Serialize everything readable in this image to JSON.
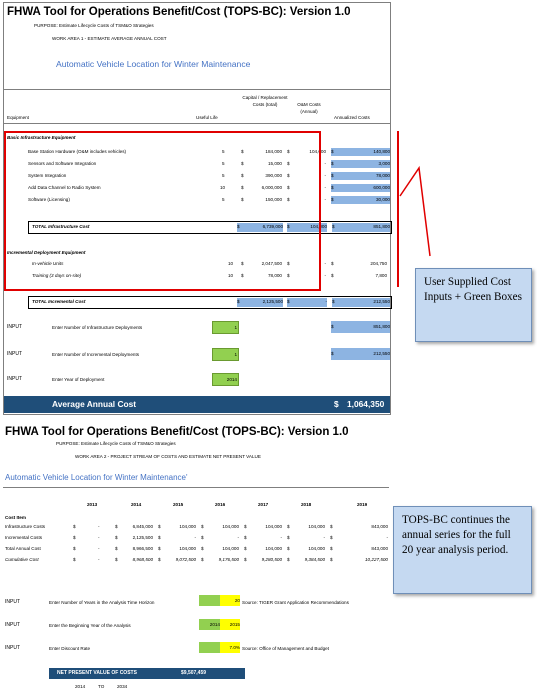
{
  "top": {
    "title": "FHWA Tool for Operations Benefit/Cost (TOPS-BC):  Version 1.0",
    "purpose": "PURPOSE: Estimate Lifecycle Costs of TSM&O Strategies",
    "work_area": "WORK AREA 1 - ESTIMATE AVERAGE ANNUAL COST",
    "subtitle": "Automatic Vehicle Location for Winter Maintenance",
    "headers": {
      "equipment": "Equipment",
      "useful_life": "Useful Life",
      "capital": "Capital / Replacement Costs (total)",
      "om": "O&M Costs (Annual)",
      "annualized": "Annualized Costs"
    },
    "basic_section": "Basic Infrastructure Equipment",
    "basic_rows": [
      {
        "name": "Base Station Hardware (O&M includes vehicles)",
        "life": "5",
        "capital": "184,000",
        "om": "104,000",
        "annual": "140,800"
      },
      {
        "name": "Sensors and Software Integration",
        "life": "5",
        "capital": "15,000",
        "om": "-",
        "annual": "3,000"
      },
      {
        "name": "System Integration",
        "life": "5",
        "capital": "390,000",
        "om": "-",
        "annual": "78,000"
      },
      {
        "name": "Add Data Channel to Radio System",
        "life": "10",
        "capital": "6,000,000",
        "om": "-",
        "annual": "600,000"
      },
      {
        "name": "Software (Licensing)",
        "life": "5",
        "capital": "150,000",
        "om": "-",
        "annual": "30,000"
      }
    ],
    "total_infra": {
      "label": "TOTAL Infrastructure Cost",
      "capital": "6,739,000",
      "om": "104,000",
      "annual": "851,800"
    },
    "incr_section": "Incremental Deployment Equipment",
    "incr_rows": [
      {
        "name": "In-vehicle Units",
        "life": "10",
        "capital": "2,047,500",
        "om": "-",
        "annual": "204,750"
      },
      {
        "name": "Training (3 days on-site)",
        "life": "10",
        "capital": "78,000",
        "om": "-",
        "annual": "7,800"
      }
    ],
    "total_incr": {
      "label": "TOTAL Incremental Cost",
      "capital": "2,125,500",
      "om": "-",
      "annual": "212,550"
    },
    "inputs": [
      {
        "tag": "INPUT",
        "label": "Enter Number of Infrastructure Deployments",
        "value": "1",
        "result": "851,800"
      },
      {
        "tag": "INPUT",
        "label": "Enter Number of Incremental Deployments",
        "value": "1",
        "result": "212,550"
      },
      {
        "tag": "INPUT",
        "label": "Enter Year of Deployment",
        "value": "2014",
        "result": ""
      }
    ],
    "avg_label": "Average Annual Cost",
    "avg_currency": "$",
    "avg_value": "1,064,350"
  },
  "callout1": {
    "text": "User Supplied Cost Inputs + Green Boxes"
  },
  "bottom": {
    "title": "FHWA Tool for Operations Benefit/Cost (TOPS-BC):  Version 1.0",
    "purpose": "PURPOSE: Estimate Lifecycle Costs of TSM&O Strategies",
    "work_area": "WORK AREA 2 - PROJECT STREAM OF COSTS AND ESTIMATE NET PRESENT VALUE",
    "subtitle": "Automatic Vehicle Location for Winter Maintenance'",
    "years": [
      "2013",
      "2014",
      "2015",
      "2016",
      "2017",
      "2018",
      "2019"
    ],
    "cost_item": "Cost Item",
    "rows": [
      {
        "label": "Infrastructure Costs",
        "values": [
          "-",
          "6,845,000",
          "104,000",
          "104,000",
          "104,000",
          "104,000",
          "843,000"
        ]
      },
      {
        "label": "Incremental Costs",
        "values": [
          "-",
          "2,125,500",
          "-",
          "-",
          "-",
          "-",
          "-"
        ]
      },
      {
        "label": "Total Annual Cost",
        "values": [
          "-",
          "8,966,500",
          "104,000",
          "104,000",
          "104,000",
          "104,000",
          "843,000"
        ]
      },
      {
        "label": "Cumulative Cost",
        "values": [
          "-",
          "8,968,500",
          "9,072,500",
          "9,176,500",
          "9,280,500",
          "9,384,500",
          "10,227,500"
        ]
      }
    ],
    "inputs": [
      {
        "tag": "INPUT",
        "label": "Enter Number of Years in the Analysis Time Horizon",
        "value": "20",
        "note": "Source: TIGER Grant Application Recommendations"
      },
      {
        "tag": "INPUT",
        "label": "Enter the Beginning Year of the Analysis",
        "value": "2014",
        "value2": "2015"
      },
      {
        "tag": "INPUT",
        "label": "Enter Discount Rate",
        "value": "7.0%",
        "note": "Source: Office of Management and Budget"
      }
    ],
    "npv_label": "NET PRESENT VALUE OF COSTS",
    "npv_value": "$9,507,459",
    "range_from": "2014",
    "range_to": "TO",
    "range_end": "2034"
  },
  "callout2": {
    "text": "TOPS-BC continues the annual series for the full 20 year analysis period."
  },
  "dollar": "$",
  "colors": {
    "blue_cell": "#8db4e2",
    "green_input": "#92d050",
    "avg_bar": "#1f4e79",
    "npv_bar": "#1f4e79",
    "highlight_red": "#e00000",
    "callout_bg": "#c5d9f1"
  }
}
